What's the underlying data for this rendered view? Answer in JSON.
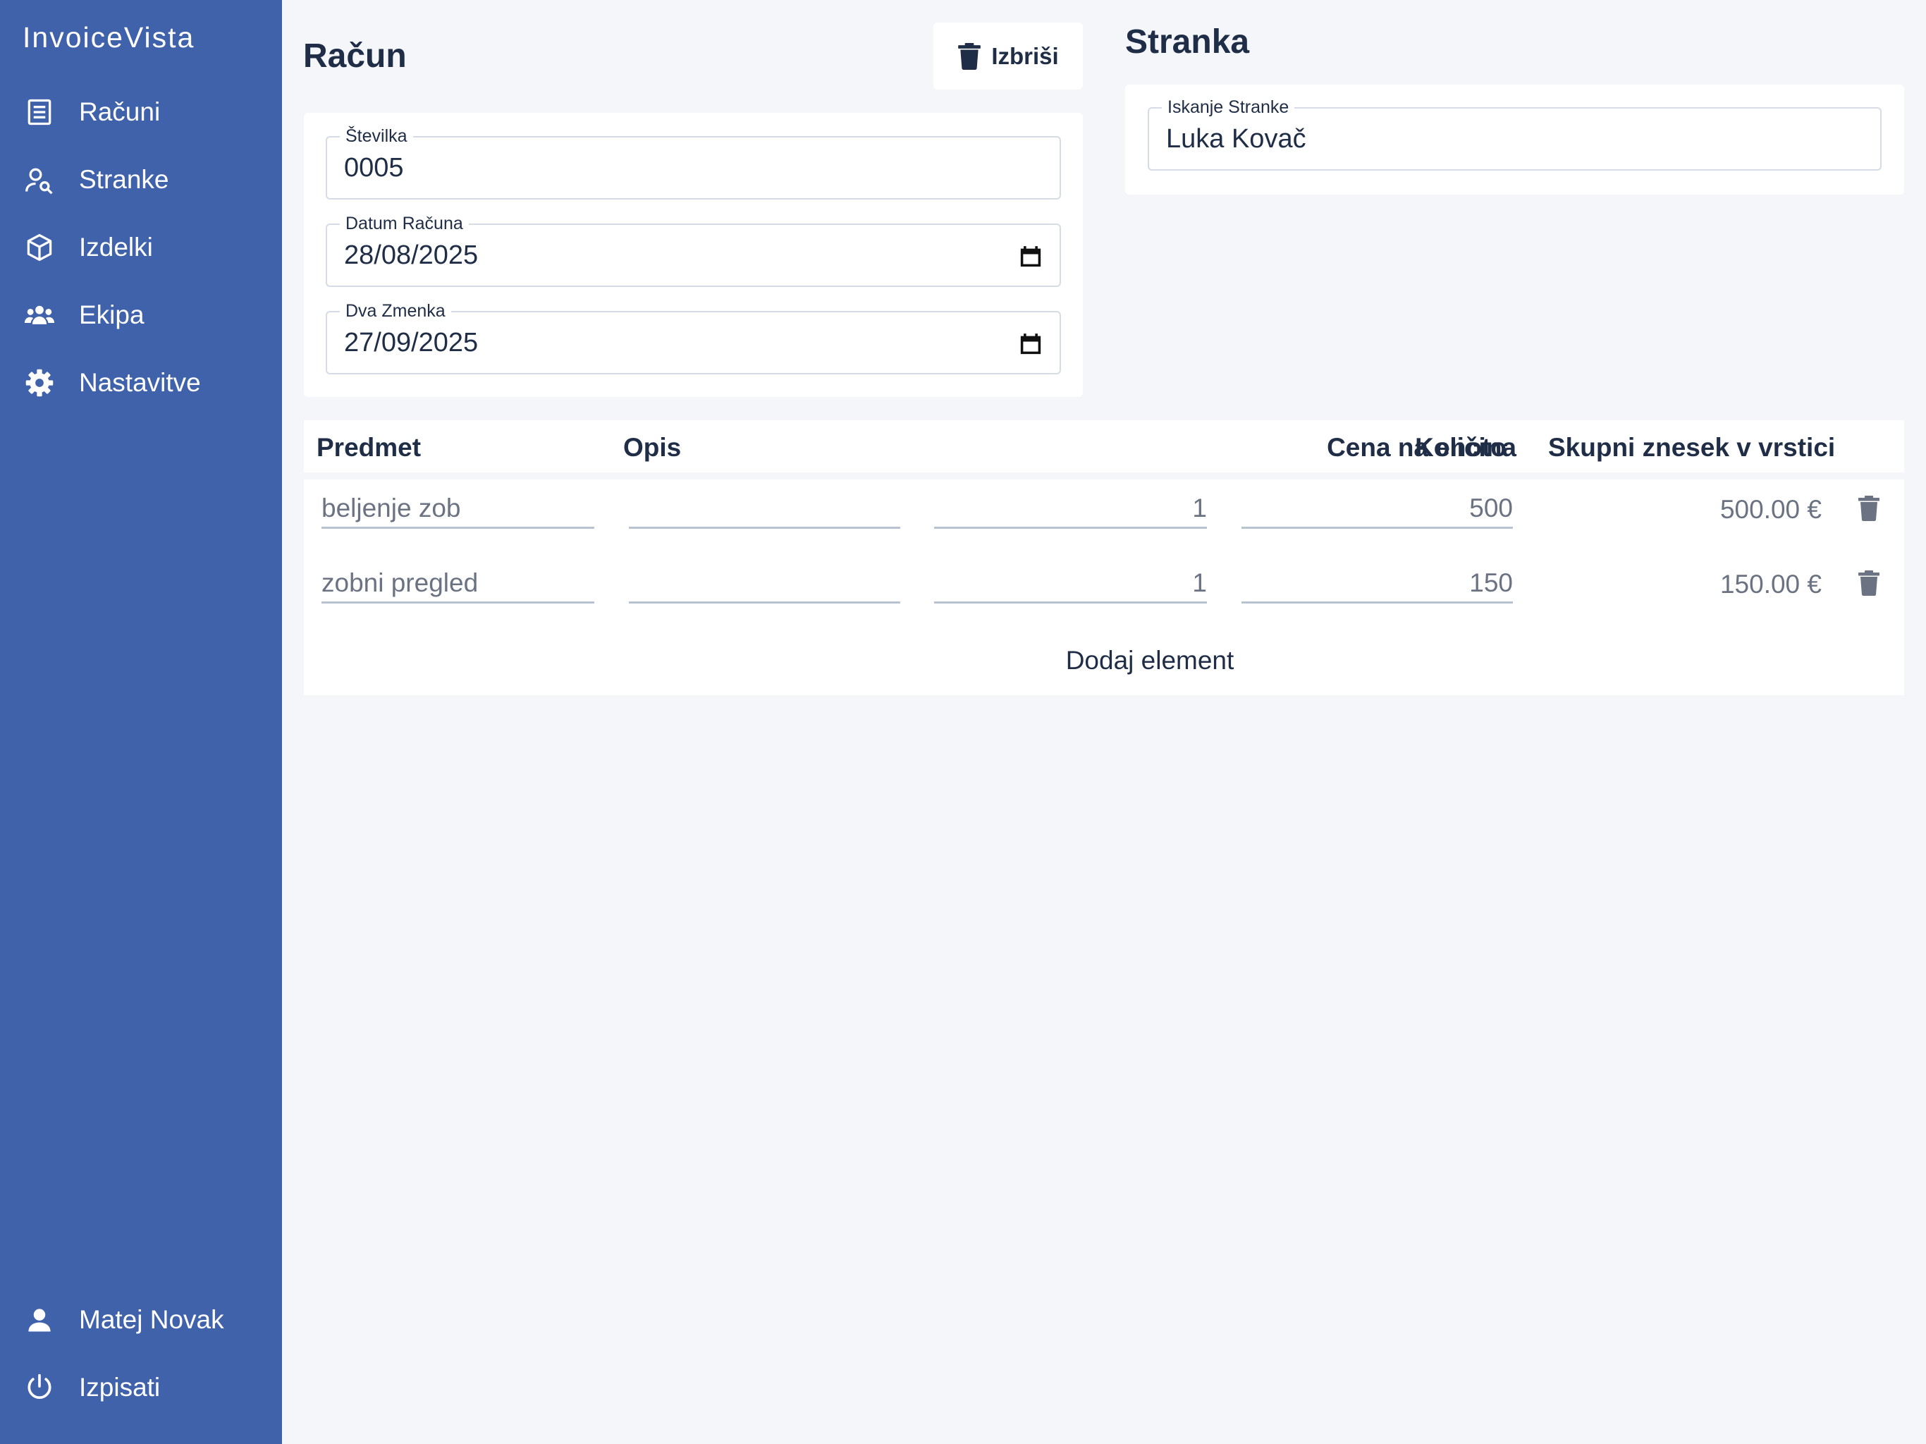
{
  "app": {
    "name": "InvoiceVista"
  },
  "sidebar": {
    "items": [
      {
        "label": "Računi",
        "icon": "receipt-icon"
      },
      {
        "label": "Stranke",
        "icon": "user-search-icon"
      },
      {
        "label": "Izdelki",
        "icon": "cube-icon"
      },
      {
        "label": "Ekipa",
        "icon": "users-icon"
      },
      {
        "label": "Nastavitve",
        "icon": "gear-icon"
      }
    ],
    "user": {
      "label": "Matej Novak",
      "icon": "user-icon"
    },
    "logout": {
      "label": "Izpisati",
      "icon": "power-icon"
    }
  },
  "invoice": {
    "title": "Račun",
    "delete_label": "Izbriši",
    "number": {
      "label": "Številka",
      "value": "0005"
    },
    "date": {
      "label": "Datum Računa",
      "value": "28/08/2025"
    },
    "due": {
      "label": "Dva Zmenka",
      "value": "27/09/2025"
    }
  },
  "customer": {
    "title": "Stranka",
    "search": {
      "label": "Iskanje Stranke",
      "value": "Luka Kovač"
    }
  },
  "items_table": {
    "headers": {
      "item": "Predmet",
      "description": "Opis",
      "quantity": "Količina",
      "unit_price": "Cena na enoto",
      "line_total": "Skupni znesek v vrstici"
    },
    "rows": [
      {
        "item": "beljenje zob",
        "description": "",
        "quantity": "1",
        "unit_price": "500",
        "line_total": "500.00 €"
      },
      {
        "item": "zobni pregled",
        "description": "",
        "quantity": "1",
        "unit_price": "150",
        "line_total": "150.00 €"
      }
    ],
    "add_label": "Dodaj element"
  },
  "colors": {
    "sidebar": "#3f62ab",
    "background": "#f4f6fa",
    "text": "#1f2d46",
    "muted": "#6b7383"
  }
}
